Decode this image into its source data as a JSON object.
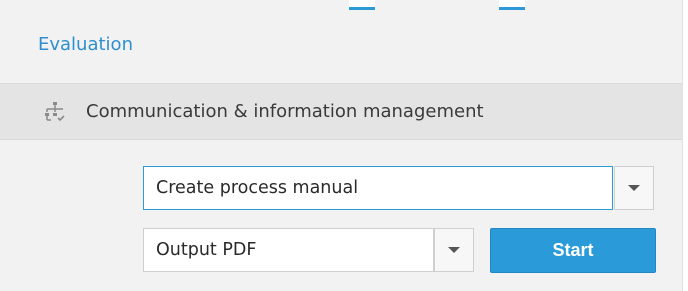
{
  "navigation": {
    "evaluation_link": "Evaluation"
  },
  "section": {
    "title": "Communication & information management",
    "icon": "process-hierarchy-icon"
  },
  "process_select": {
    "value": "Create process manual",
    "dropdown_icon": "caret-down-icon"
  },
  "output_select": {
    "value": "Output PDF",
    "dropdown_icon": "caret-down-icon"
  },
  "start_button": {
    "label": "Start"
  },
  "colors": {
    "accent": "#2a9ad9",
    "link": "#2d8fcf",
    "panel_background": "#f2f2f2",
    "header_background": "#e4e4e4"
  }
}
